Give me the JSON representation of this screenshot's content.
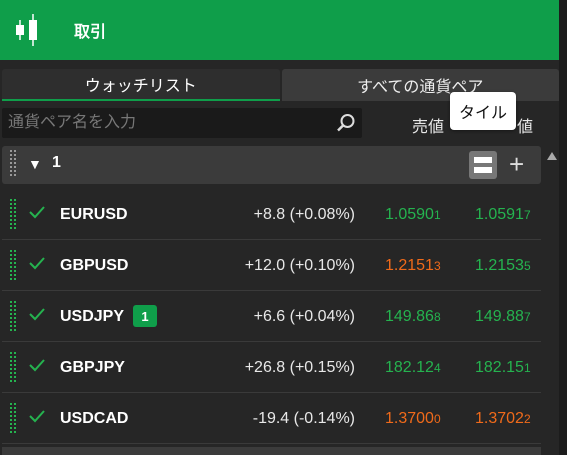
{
  "header": {
    "title": "取引"
  },
  "tabs": [
    {
      "label": "ウォッチリスト",
      "active": true
    },
    {
      "label": "すべての通貨ペア",
      "active": false
    }
  ],
  "search": {
    "placeholder": "通貨ペア名を入力",
    "value": ""
  },
  "columns": {
    "sell": "売値",
    "buy": "値"
  },
  "tooltip": {
    "text": "タイル"
  },
  "group": {
    "name": "1"
  },
  "colors": {
    "accent": "#0f9e4a",
    "up": "#25b34f",
    "down": "#f06a1a"
  },
  "rows": [
    {
      "symbol": "EURUSD",
      "badge": "",
      "change": "+8.8 (+0.08%)",
      "sell_main": "1.0590",
      "sell_pip": "1",
      "sell_color": "#25b34f",
      "buy_main": "1.0591",
      "buy_pip": "7",
      "buy_color": "#25b34f"
    },
    {
      "symbol": "GBPUSD",
      "badge": "",
      "change": "+12.0 (+0.10%)",
      "sell_main": "1.2151",
      "sell_pip": "3",
      "sell_color": "#f06a1a",
      "buy_main": "1.2153",
      "buy_pip": "5",
      "buy_color": "#25b34f"
    },
    {
      "symbol": "USDJPY",
      "badge": "1",
      "change": "+6.6 (+0.04%)",
      "sell_main": "149.86",
      "sell_pip": "8",
      "sell_color": "#25b34f",
      "buy_main": "149.88",
      "buy_pip": "7",
      "buy_color": "#25b34f"
    },
    {
      "symbol": "GBPJPY",
      "badge": "",
      "change": "+26.8 (+0.15%)",
      "sell_main": "182.12",
      "sell_pip": "4",
      "sell_color": "#25b34f",
      "buy_main": "182.15",
      "buy_pip": "1",
      "buy_color": "#25b34f"
    },
    {
      "symbol": "USDCAD",
      "badge": "",
      "change": "-19.4 (-0.14%)",
      "sell_main": "1.3700",
      "sell_pip": "0",
      "sell_color": "#f06a1a",
      "buy_main": "1.3702",
      "buy_pip": "2",
      "buy_color": "#f06a1a"
    }
  ]
}
